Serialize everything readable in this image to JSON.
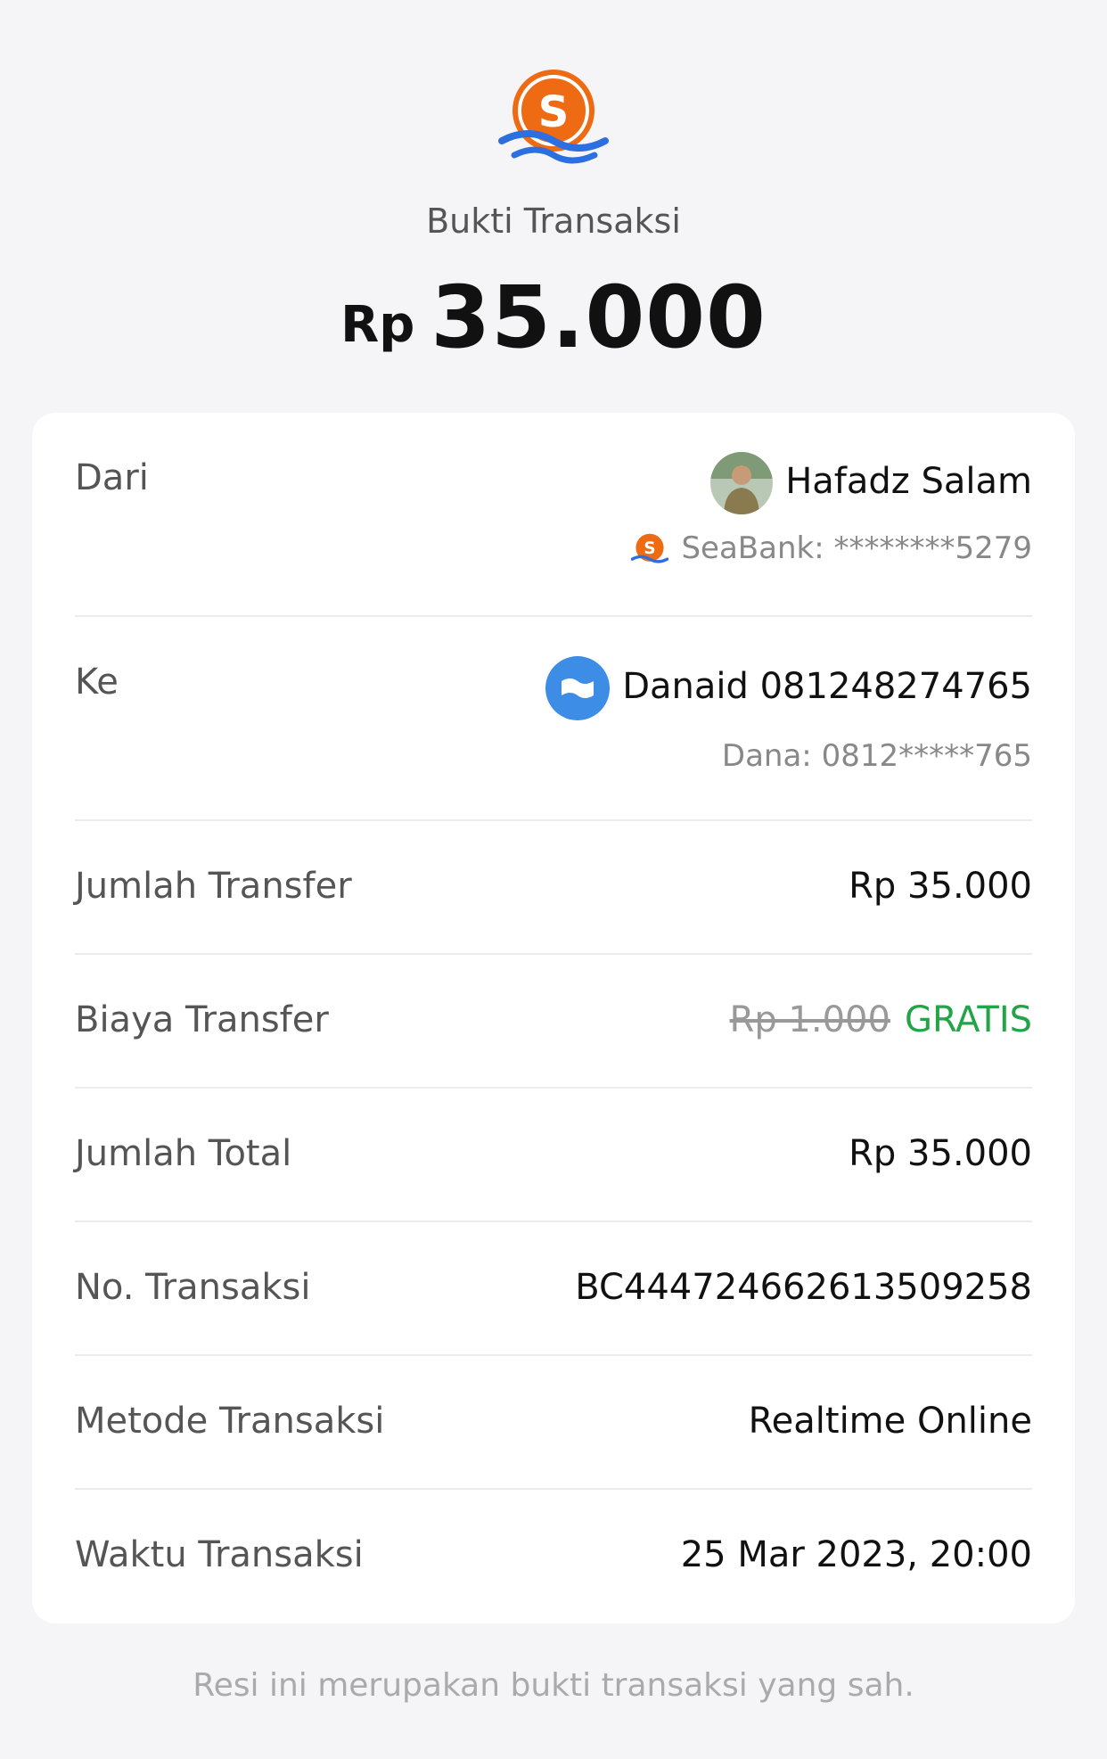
{
  "header": {
    "logo_icon": "seabank-logo-icon",
    "title": "Bukti Transaksi",
    "currency": "Rp",
    "amount": "35.000"
  },
  "from": {
    "label": "Dari",
    "name": "Hafadz Salam",
    "account": "SeaBank: ********5279",
    "avatar_icon": "user-avatar",
    "bank_icon": "seabank-logo-icon"
  },
  "to": {
    "label": "Ke",
    "name": "Danaid 081248274765",
    "account": "Dana: 0812*****765",
    "icon": "dana-logo-icon"
  },
  "rows": {
    "jumlah_transfer": {
      "label": "Jumlah Transfer",
      "value": "Rp 35.000"
    },
    "biaya_transfer": {
      "label": "Biaya Transfer",
      "old_value": "Rp 1.000",
      "value": "GRATIS"
    },
    "jumlah_total": {
      "label": "Jumlah Total",
      "value": "Rp 35.000"
    },
    "no_transaksi": {
      "label": "No. Transaksi",
      "value": "BC444724662613509258"
    },
    "metode_transaksi": {
      "label": "Metode Transaksi",
      "value": "Realtime Online"
    },
    "waktu_transaksi": {
      "label": "Waktu Transaksi",
      "value": "25 Mar 2023, 20:00"
    }
  },
  "footer": {
    "note": "Resi ini merupakan bukti transaksi yang sah."
  },
  "colors": {
    "brand_orange": "#ee6a13",
    "wave_blue": "#2c6fe0",
    "dana_blue": "#3d8de6",
    "free_green": "#22a447",
    "background": "#f5f5f7"
  }
}
